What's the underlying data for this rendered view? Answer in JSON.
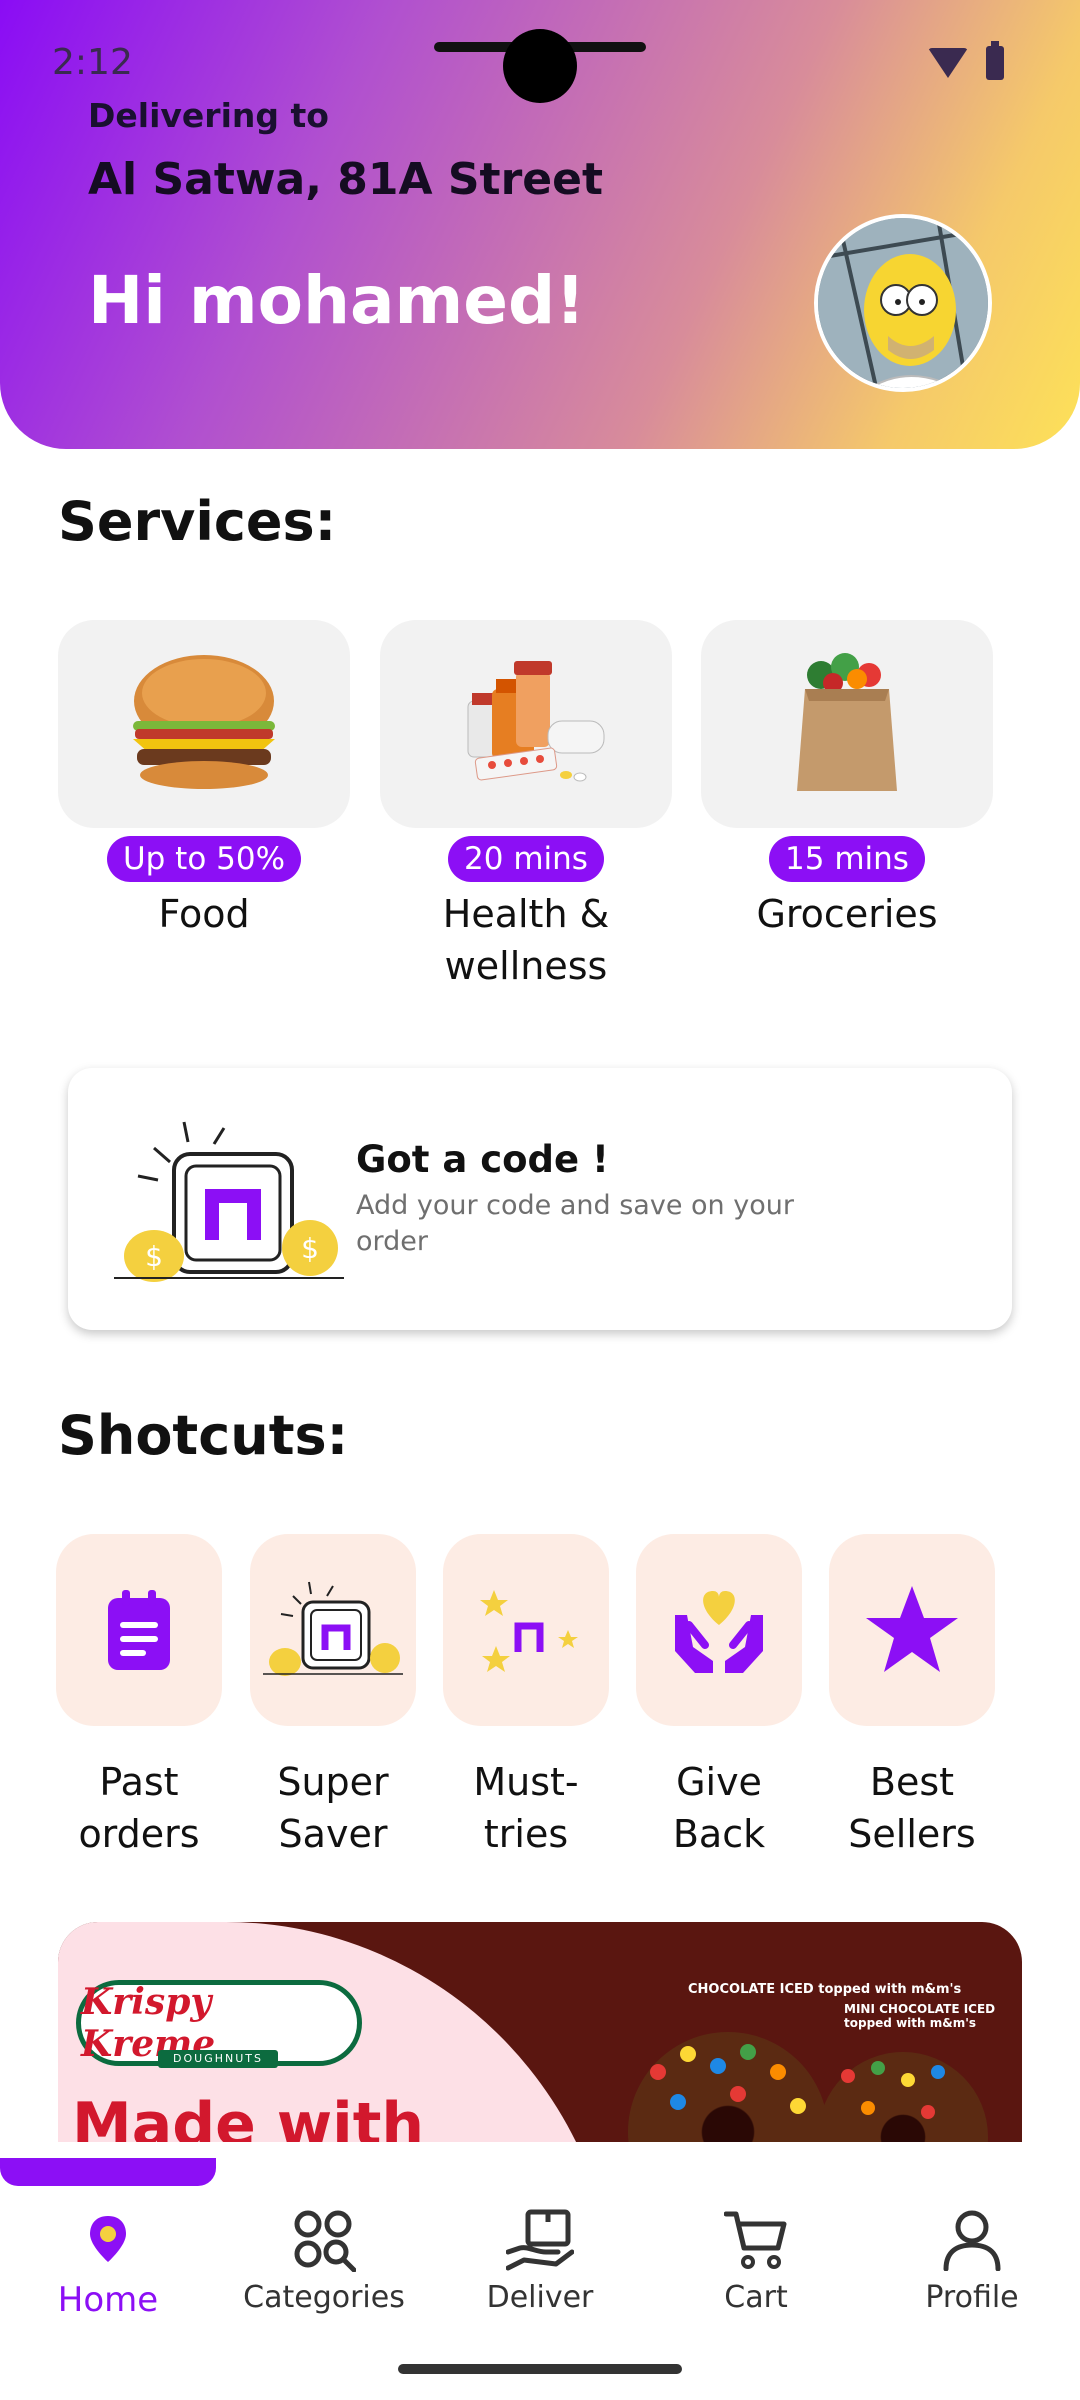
{
  "status_bar": {
    "time": "2:12"
  },
  "header": {
    "deliver_label": "Delivering to",
    "address": "Al Satwa, 81A Street",
    "greeting": "Hi mohamed!"
  },
  "services": {
    "title": "Services:",
    "items": [
      {
        "badge": "Up to 50%",
        "label": "Food"
      },
      {
        "badge": "20 mins",
        "label": "Health & wellness"
      },
      {
        "badge": "15 mins",
        "label": "Groceries"
      }
    ]
  },
  "code_card": {
    "title": "Got a code !",
    "description": "Add your code and save on your order"
  },
  "shortcuts": {
    "title": "Shotcuts:",
    "items": [
      {
        "label": "Past orders",
        "icon": "clipboard-icon"
      },
      {
        "label": "Super Saver",
        "icon": "super-saver-icon"
      },
      {
        "label": "Must-tries",
        "icon": "must-tries-icon"
      },
      {
        "label": "Give Back",
        "icon": "give-back-icon"
      },
      {
        "label": "Best Sellers",
        "icon": "star-icon"
      }
    ]
  },
  "banner": {
    "brand": "Krispy Kreme",
    "brand_sub": "DOUGHNUTS",
    "tagline": "Made with",
    "tag1": "CHOCOLATE ICED topped with m&m's",
    "tag2": "MINI CHOCOLATE ICED topped with m&m's"
  },
  "nav": {
    "items": [
      {
        "label": "Home",
        "icon": "home-icon",
        "active": true
      },
      {
        "label": "Categories",
        "icon": "categories-icon"
      },
      {
        "label": "Deliver",
        "icon": "deliver-icon"
      },
      {
        "label": "Cart",
        "icon": "cart-icon"
      },
      {
        "label": "Profile",
        "icon": "profile-icon"
      }
    ]
  },
  "colors": {
    "accent": "#8c0ff5",
    "shortcut_bg": "#fdece4",
    "service_bg": "#f2f2f2"
  }
}
